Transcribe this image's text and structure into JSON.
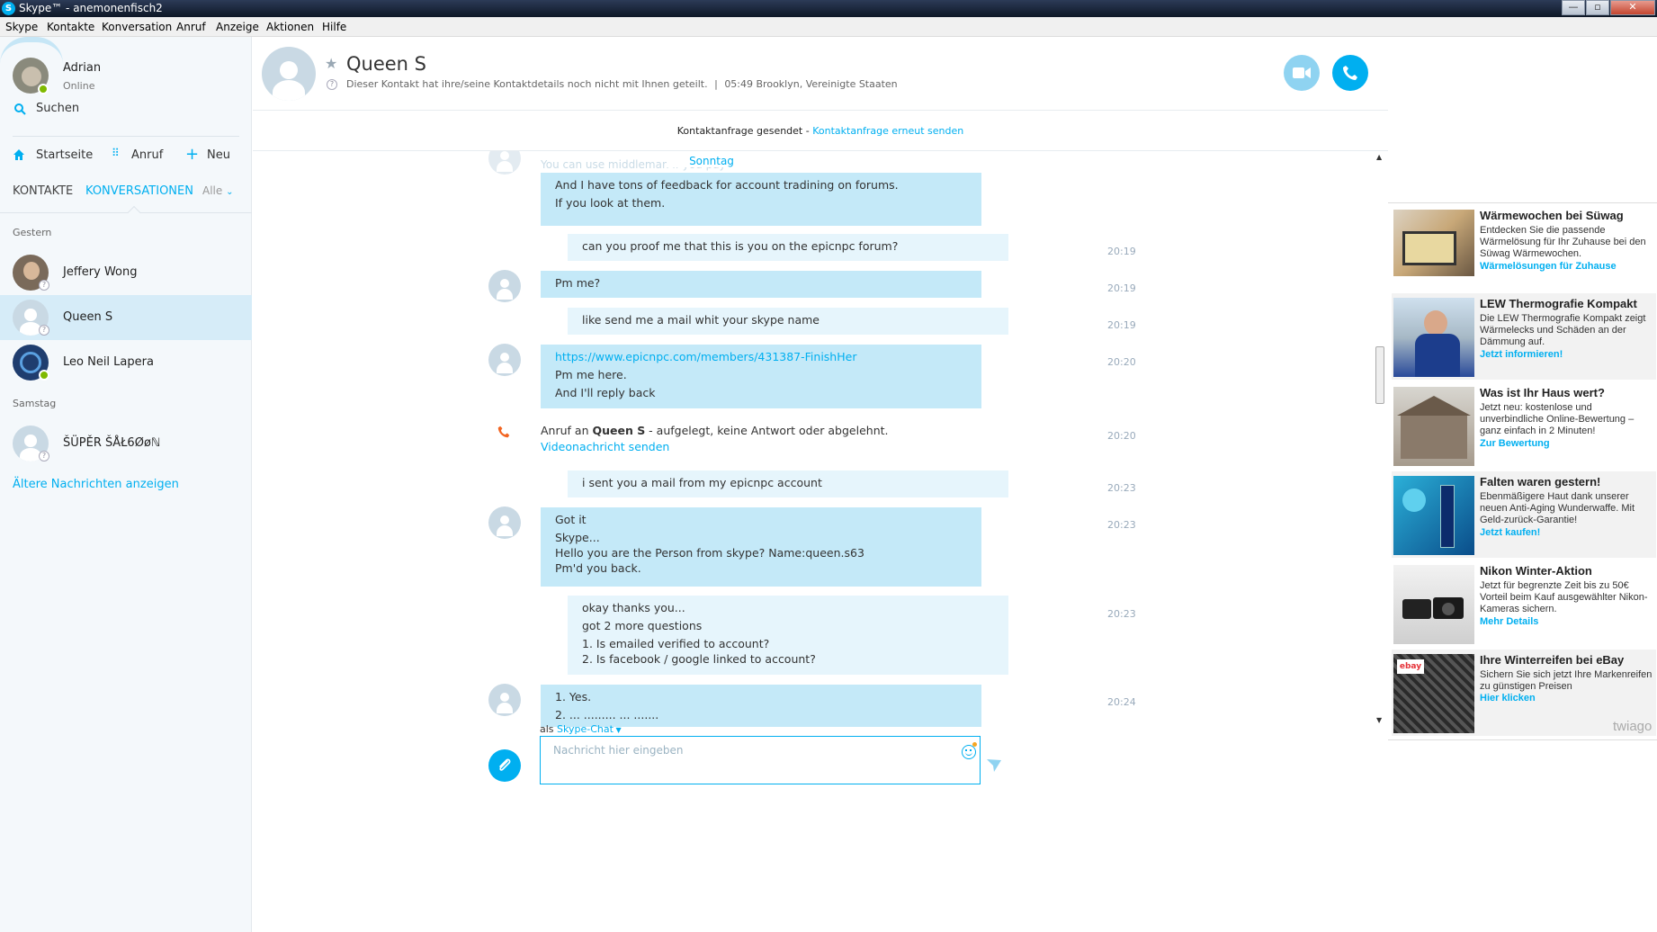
{
  "window": {
    "title": "Skype™ - anemonenfisch2",
    "app_icon": "S",
    "minimize": "—",
    "maximize": "▫",
    "close": "✕"
  },
  "menu": [
    "Skype",
    "Kontakte",
    "Konversation",
    "Anruf",
    "Anzeige",
    "Aktionen",
    "Hilfe"
  ],
  "sidebar": {
    "profile": {
      "name": "Adrian",
      "status": "Online"
    },
    "search_label": "Suchen",
    "actions": {
      "home": "Startseite",
      "call": "Anruf",
      "new": "Neu"
    },
    "tabs": {
      "contacts": "KONTAKTE",
      "conversations": "KONVERSATIONEN",
      "filter": "Alle"
    },
    "groups": {
      "yesterday": "Gestern",
      "saturday": "Samstag"
    },
    "conversations": [
      {
        "name": "Jeffery Wong"
      },
      {
        "name": "Queen S"
      },
      {
        "name": "Leo Neil Lapera"
      },
      {
        "name": "ŠÜPĚR ŠÅŁ6Øøℕ"
      }
    ],
    "older_link": "Ältere Nachrichten anzeigen"
  },
  "contact": {
    "name": "Queen S",
    "detail": "Dieser Kontakt hat ihre/seine Kontaktdetails noch nicht mit Ihnen geteilt.",
    "location": "05:49 Brooklyn, Vereinigte Staaten"
  },
  "request": {
    "text": "Kontaktanfrage gesendet - ",
    "link": "Kontaktanfrage erneut senden"
  },
  "chat": {
    "day": "Sonntag",
    "partial_top": "You can use middleman if you pay",
    "m1": {
      "lines": [
        "And I have tons of feedback for account tradining on forums.",
        "If you look at them."
      ]
    },
    "m2": {
      "text": "can you proof me that this is you on the epicnpc forum?",
      "time": "20:19"
    },
    "m3": {
      "text": "Pm me?",
      "time": "20:19"
    },
    "m4": {
      "text": "like send me a mail whit your skype name",
      "time": "20:19"
    },
    "m5": {
      "link": "https://www.epicnpc.com/members/431387-FinishHer",
      "lines": [
        "Pm me here.",
        "And I'll reply back"
      ],
      "time": "20:20"
    },
    "call": {
      "prefix": "Anruf an ",
      "name": "Queen S",
      "suffix": " - aufgelegt, keine Antwort oder abgelehnt.",
      "link": "Videonachricht senden",
      "time": "20:20"
    },
    "m6": {
      "text": "i sent you a mail from my epicnpc account",
      "time": "20:23"
    },
    "m7": {
      "lines": [
        "Got it",
        "Skype...",
        "Hello you are the Person from skype? Name:queen.s63",
        "Pm'd you back."
      ],
      "time": "20:23"
    },
    "m8": {
      "lines": [
        "okay thanks you...",
        "got 2 more questions",
        "1. Is emailed verified to account?",
        "2. Is facebook / google linked to account?"
      ],
      "time": "20:23"
    },
    "m9": {
      "lines": [
        "1. Yes.",
        "2. ... ......... ... ......."
      ],
      "time": "20:24"
    }
  },
  "compose": {
    "mode_prefix": "als ",
    "mode": "Skype-Chat",
    "placeholder": "Nachricht hier eingeben"
  },
  "ads": [
    {
      "title": "Wärmewochen bei Süwag",
      "desc": "Entdecken Sie die passende Wärmelösung für Ihr Zuhause bei den Süwag Wärmewochen.",
      "link": "Wärmelösungen für Zuhause"
    },
    {
      "title": "LEW Thermografie Kompakt",
      "desc": "Die LEW Thermografie Kompakt zeigt Wärmelecks und Schäden an der Dämmung auf.",
      "link": "Jetzt informieren!"
    },
    {
      "title": "Was ist Ihr Haus wert?",
      "desc": "Jetzt neu: kostenlose und unverbindliche Online-Bewertung – ganz einfach in 2 Minuten!",
      "link": "Zur Bewertung"
    },
    {
      "title": "Falten waren gestern!",
      "desc": "Ebenmäßigere Haut dank unserer neuen Anti-Aging Wunderwaffe. Mit Geld-zurück-Garantie!",
      "link": "Jetzt kaufen!"
    },
    {
      "title": "Nikon Winter-Aktion",
      "desc": "Jetzt für begrenzte Zeit bis zu 50€ Vorteil beim Kauf ausgewählter Nikon-Kameras sichern.",
      "link": "Mehr Details"
    },
    {
      "title": "Ihre Winterreifen bei eBay",
      "desc": "Sichern Sie sich jetzt Ihre Markenreifen zu günstigen Preisen",
      "link": "Hier klicken"
    }
  ],
  "ad_brand": "twiago",
  "colors": {
    "accent": "#00aff0",
    "bubble_in": "#c4e9f8",
    "bubble_out": "#e6f5fc",
    "selected": "#d6ecf8",
    "online": "#7fba00",
    "call": "#f26522"
  }
}
